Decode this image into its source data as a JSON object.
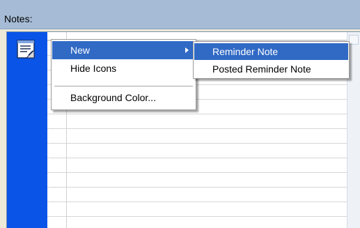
{
  "header": {
    "title": "Notes:"
  },
  "context_menu": {
    "items": [
      {
        "label": "New",
        "highlighted": true,
        "has_submenu": true
      },
      {
        "label": "Hide Icons"
      },
      {
        "label": "Background Color..."
      }
    ]
  },
  "submenu": {
    "items": [
      {
        "label": "Reminder Note",
        "highlighted": true
      },
      {
        "label": "Posted Reminder Note"
      }
    ]
  },
  "icons": {
    "notes": "notes-icon",
    "submenu_arrow": "chevron-right-icon"
  },
  "colors": {
    "header_bg": "#a6bcd6",
    "strip_bg": "#0a55e8",
    "highlight": "#316ac5",
    "window_bg": "#ece9d8"
  }
}
